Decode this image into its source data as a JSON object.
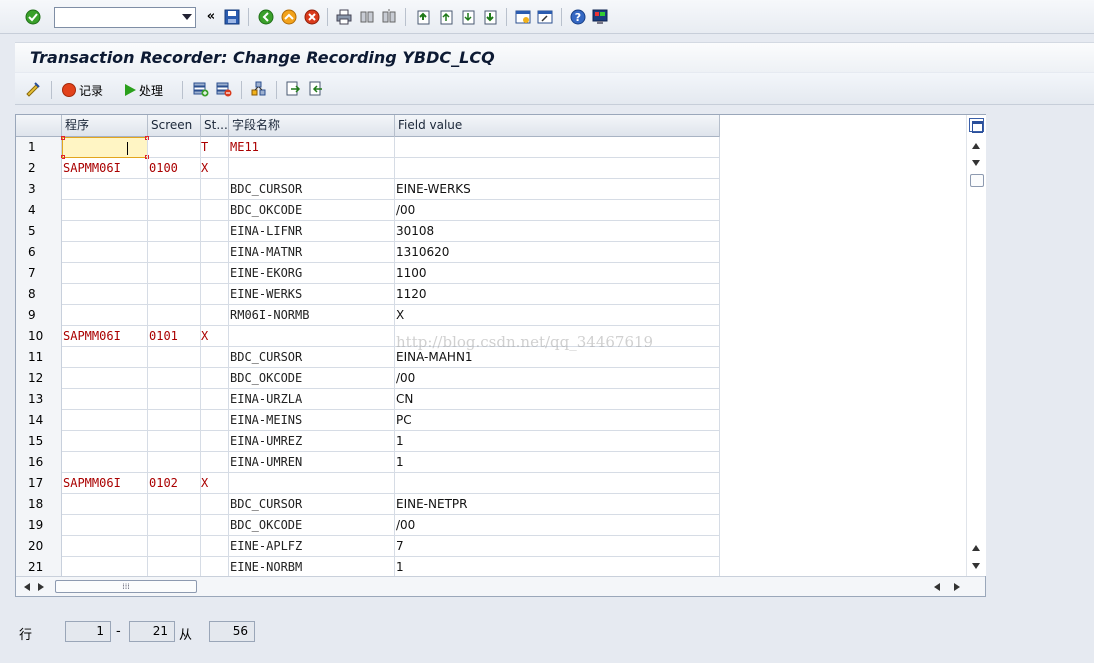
{
  "toolbar": {
    "command_value": "",
    "icons": [
      "enter-icon",
      "save-icon",
      "back-icon",
      "exit-icon",
      "cancel-icon",
      "print-icon",
      "find-icon",
      "find-next-icon",
      "first-page-icon",
      "previous-page-icon",
      "next-page-icon",
      "last-page-icon",
      "create-session-icon",
      "shortcut-icon",
      "help-icon",
      "customize-layout-icon"
    ]
  },
  "title": "Transaction Recorder: Change Recording YBDC_LCQ",
  "app_toolbar": {
    "record_label": "记录",
    "process_label": "处理"
  },
  "table": {
    "columns": {
      "program": "程序",
      "screen": "Screen",
      "start": "St...",
      "field_name": "字段名称",
      "field_value": "Field value"
    },
    "rows": [
      {
        "n": "1",
        "program": "",
        "screen": "",
        "st": "T",
        "field": "ME11",
        "value": ""
      },
      {
        "n": "2",
        "program": "SAPMM06I",
        "screen": "0100",
        "st": "X",
        "field": "",
        "value": ""
      },
      {
        "n": "3",
        "program": "",
        "screen": "",
        "st": "",
        "field": "BDC_CURSOR",
        "value": "EINE-WERKS"
      },
      {
        "n": "4",
        "program": "",
        "screen": "",
        "st": "",
        "field": "BDC_OKCODE",
        "value": "/00"
      },
      {
        "n": "5",
        "program": "",
        "screen": "",
        "st": "",
        "field": "EINA-LIFNR",
        "value": "30108"
      },
      {
        "n": "6",
        "program": "",
        "screen": "",
        "st": "",
        "field": "EINA-MATNR",
        "value": "1310620"
      },
      {
        "n": "7",
        "program": "",
        "screen": "",
        "st": "",
        "field": "EINE-EKORG",
        "value": "1100"
      },
      {
        "n": "8",
        "program": "",
        "screen": "",
        "st": "",
        "field": "EINE-WERKS",
        "value": "1120"
      },
      {
        "n": "9",
        "program": "",
        "screen": "",
        "st": "",
        "field": "RM06I-NORMB",
        "value": "X"
      },
      {
        "n": "10",
        "program": "SAPMM06I",
        "screen": "0101",
        "st": "X",
        "field": "",
        "value": ""
      },
      {
        "n": "11",
        "program": "",
        "screen": "",
        "st": "",
        "field": "BDC_CURSOR",
        "value": "EINA-MAHN1"
      },
      {
        "n": "12",
        "program": "",
        "screen": "",
        "st": "",
        "field": "BDC_OKCODE",
        "value": "/00"
      },
      {
        "n": "13",
        "program": "",
        "screen": "",
        "st": "",
        "field": "EINA-URZLA",
        "value": "CN"
      },
      {
        "n": "14",
        "program": "",
        "screen": "",
        "st": "",
        "field": "EINA-MEINS",
        "value": "PC"
      },
      {
        "n": "15",
        "program": "",
        "screen": "",
        "st": "",
        "field": "EINA-UMREZ",
        "value": "1"
      },
      {
        "n": "16",
        "program": "",
        "screen": "",
        "st": "",
        "field": "EINA-UMREN",
        "value": "1"
      },
      {
        "n": "17",
        "program": "SAPMM06I",
        "screen": "0102",
        "st": "X",
        "field": "",
        "value": ""
      },
      {
        "n": "18",
        "program": "",
        "screen": "",
        "st": "",
        "field": "BDC_CURSOR",
        "value": "EINE-NETPR"
      },
      {
        "n": "19",
        "program": "",
        "screen": "",
        "st": "",
        "field": "BDC_OKCODE",
        "value": "/00"
      },
      {
        "n": "20",
        "program": "",
        "screen": "",
        "st": "",
        "field": "EINE-APLFZ",
        "value": "7"
      },
      {
        "n": "21",
        "program": "",
        "screen": "",
        "st": "",
        "field": "EINE-NORBM",
        "value": "1"
      }
    ]
  },
  "watermark": "http://blog.csdn.net/qq_34467619",
  "footer": {
    "row_label": "行",
    "from": "1",
    "dash": "-",
    "to": "21",
    "of_label": "从",
    "total": "56"
  }
}
